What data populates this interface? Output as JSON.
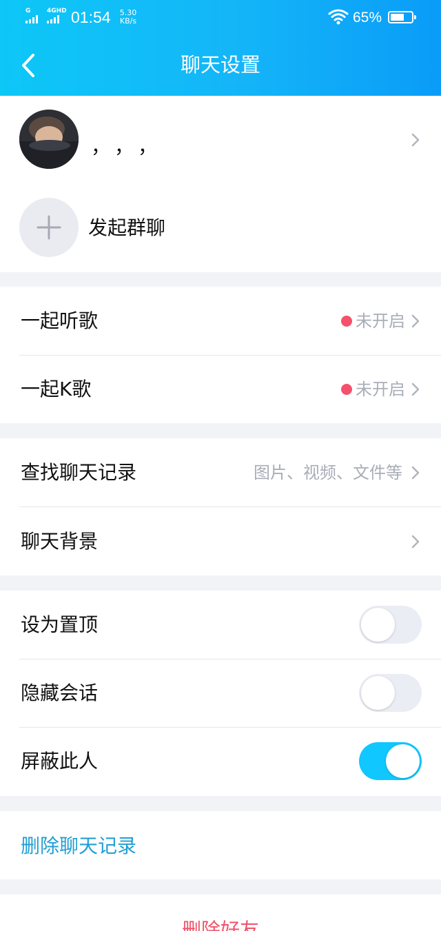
{
  "status_bar": {
    "signal1_label": "G",
    "signal2_label": "4GHD",
    "time": "01:54",
    "speed_value": "5.30",
    "speed_unit": "KB/s",
    "battery": "65%",
    "battery_level": 0.65
  },
  "nav": {
    "back_icon": "chevron-left-icon",
    "title": "聊天设置"
  },
  "profile": {
    "name": "，，，",
    "start_group_label": "发起群聊"
  },
  "together": {
    "listen_label": "一起听歌",
    "listen_status": "未开启",
    "karaoke_label": "一起K歌",
    "karaoke_status": "未开启"
  },
  "history": {
    "search_label": "查找聊天记录",
    "search_hint": "图片、视频、文件等",
    "background_label": "聊天背景"
  },
  "toggles": {
    "pin_label": "设为置顶",
    "pin_on": false,
    "hide_label": "隐藏会话",
    "hide_on": false,
    "block_label": "屏蔽此人",
    "block_on": true
  },
  "actions": {
    "delete_history": "删除聊天记录",
    "delete_friend": "删除好友"
  },
  "colors": {
    "header_gradient_start": "#0dc7f7",
    "header_gradient_end": "#0a9cf8",
    "toggle_on": "#10c7ff",
    "red_dot": "#f5516c",
    "link_blue": "#1f9fd4",
    "danger_red": "#f0526a"
  }
}
